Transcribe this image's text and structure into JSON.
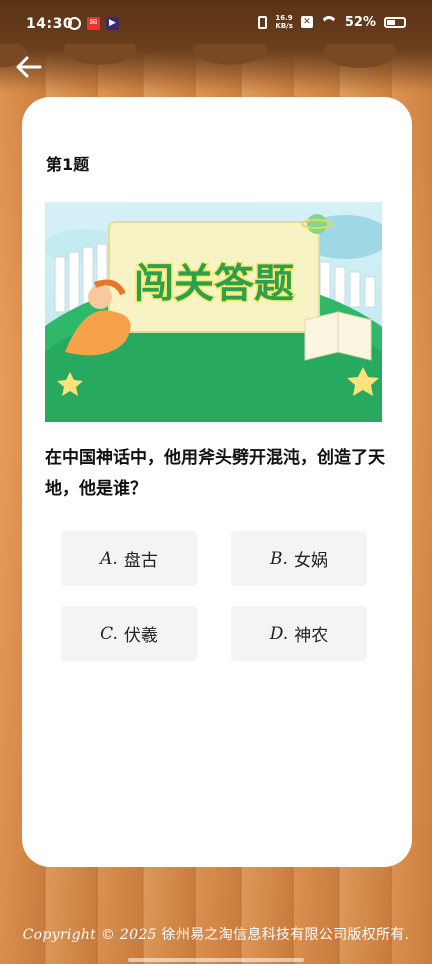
{
  "status_bar": {
    "time": "14:30",
    "net_speed_value": "16.9",
    "net_speed_unit": "KB/s",
    "battery_percent": "52%",
    "battery_level": 0.52
  },
  "quiz": {
    "question_number": "第1题",
    "banner_title": "闯关答题",
    "question_text": "在中国神话中，他用斧头劈开混沌，创造了天地，他是谁？",
    "options": [
      {
        "letter": "A.",
        "text": "盘古"
      },
      {
        "letter": "B.",
        "text": "女娲"
      },
      {
        "letter": "C.",
        "text": "伏羲"
      },
      {
        "letter": "D.",
        "text": "神农"
      }
    ]
  },
  "footer": {
    "copyright_script": "Copyright © 2025",
    "company": "徐州易之淘信息科技有限公司版权所有."
  },
  "colors": {
    "card_bg": "#ffffff",
    "option_bg": "#f4f4f4",
    "banner_title_fill": "#2e9e4f",
    "banner_title_outline": "#f3e96a",
    "grass": "#2fb86a"
  }
}
